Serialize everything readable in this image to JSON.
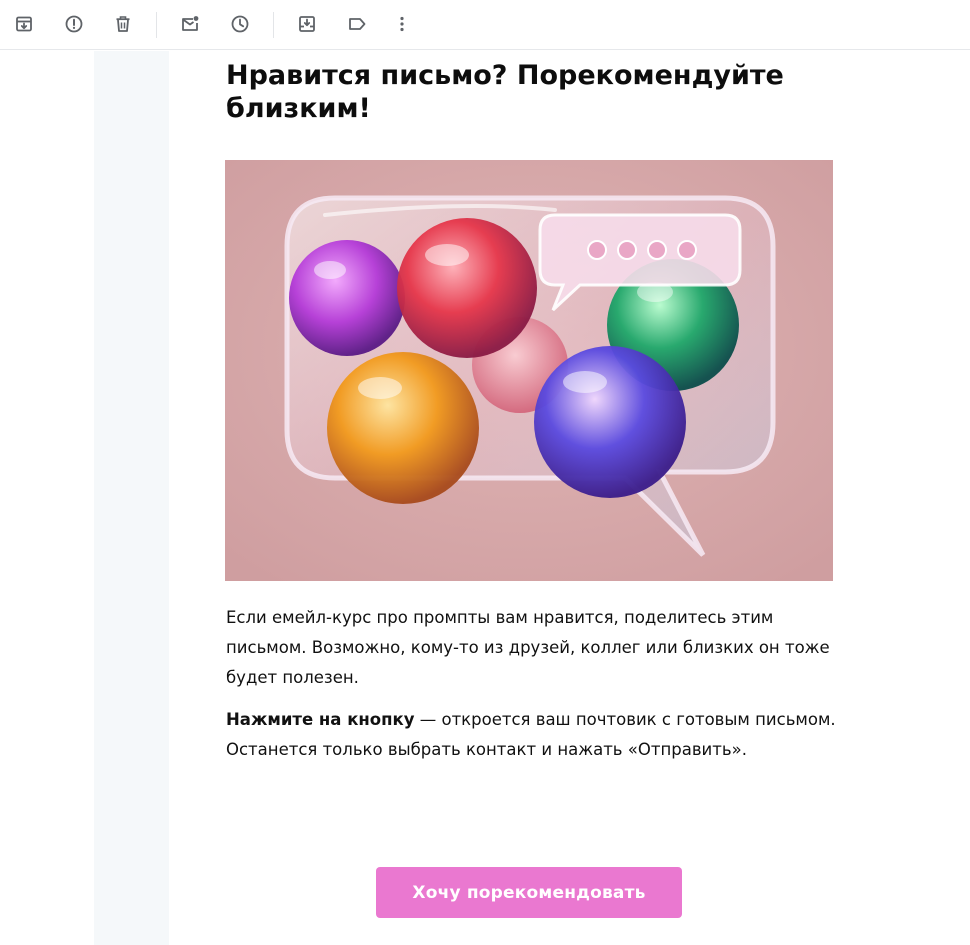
{
  "toolbar": {
    "icons": [
      "archive-icon",
      "report-spam-icon",
      "delete-icon",
      "mark-unread-icon",
      "snooze-icon",
      "move-to-icon",
      "label-icon",
      "more-vert-icon"
    ],
    "icon_color": "#5f6368"
  },
  "email": {
    "title": "Нравится письмо? Порекомендуйте близким!",
    "paragraph1": "Если емейл-курс про промпты вам нравится, поделитесь этим письмом. Возможно, кому-то из друзей, коллег или близких он тоже будет полезен.",
    "paragraph2_bold": "Нажмите на кнопку",
    "paragraph2_rest": " — откроется ваш почтовик с готовым письмом. Останется только выбрать контакт и нажать «Отправить».",
    "cta_label": "Хочу порекомендовать",
    "cta_color": "#ea78d0",
    "hero_image": "glass-speech-bubble-with-glitter-balls-illustration",
    "hero_background": "#d8aaab"
  }
}
